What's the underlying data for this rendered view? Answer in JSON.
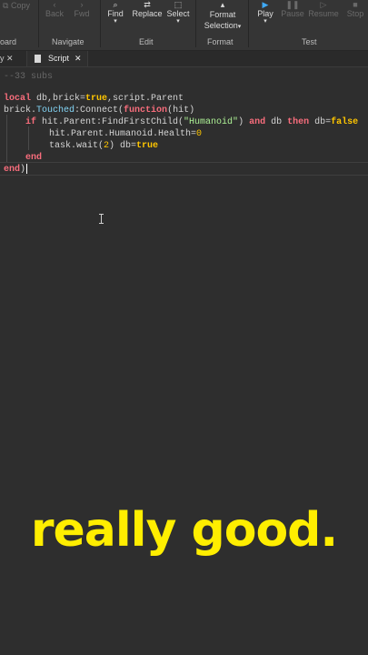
{
  "ribbon": {
    "copy": "Copy",
    "back": "Back",
    "fwd": "Fwd",
    "find": "Find",
    "replace": "Replace",
    "select": "Select",
    "format_selection_1": "Format",
    "format_selection_2": "Selection",
    "play": "Play",
    "pause": "Pause",
    "resume": "Resume",
    "stop": "Stop",
    "groups": {
      "clipboard": "oard",
      "navigate": "Navigate",
      "edit": "Edit",
      "format": "Format",
      "test": "Test"
    }
  },
  "tabs": {
    "prev_close": "y ✕",
    "active_label": "Script",
    "active_close": "✕"
  },
  "code": {
    "comment": "--33 subs",
    "line1": {
      "kw_local": "local",
      "decl": " db,brick=",
      "true": "true",
      "tail": ",script.Parent"
    },
    "line2": {
      "a": "brick.",
      "event": "Touched",
      "b": ":Connect(",
      "kw_function": "function",
      "c": "(hit)"
    },
    "line3": {
      "kw_if": "if",
      "a": " hit.Parent:FindFirstChild(",
      "str": "\"Humanoid\"",
      "b": ") ",
      "kw_and": "and",
      "c": " db ",
      "kw_then": "then",
      "d": " db=",
      "false": "false"
    },
    "line4": {
      "a": "hit.Parent.Humanoid.Health=",
      "num": "0"
    },
    "line5": {
      "a": "task.wait(",
      "num": "2",
      "b": ") db=",
      "true": "true"
    },
    "line6": {
      "kw_end": "end"
    },
    "line7": {
      "kw_end": "end",
      "tail": ")"
    }
  },
  "caption": "really good."
}
